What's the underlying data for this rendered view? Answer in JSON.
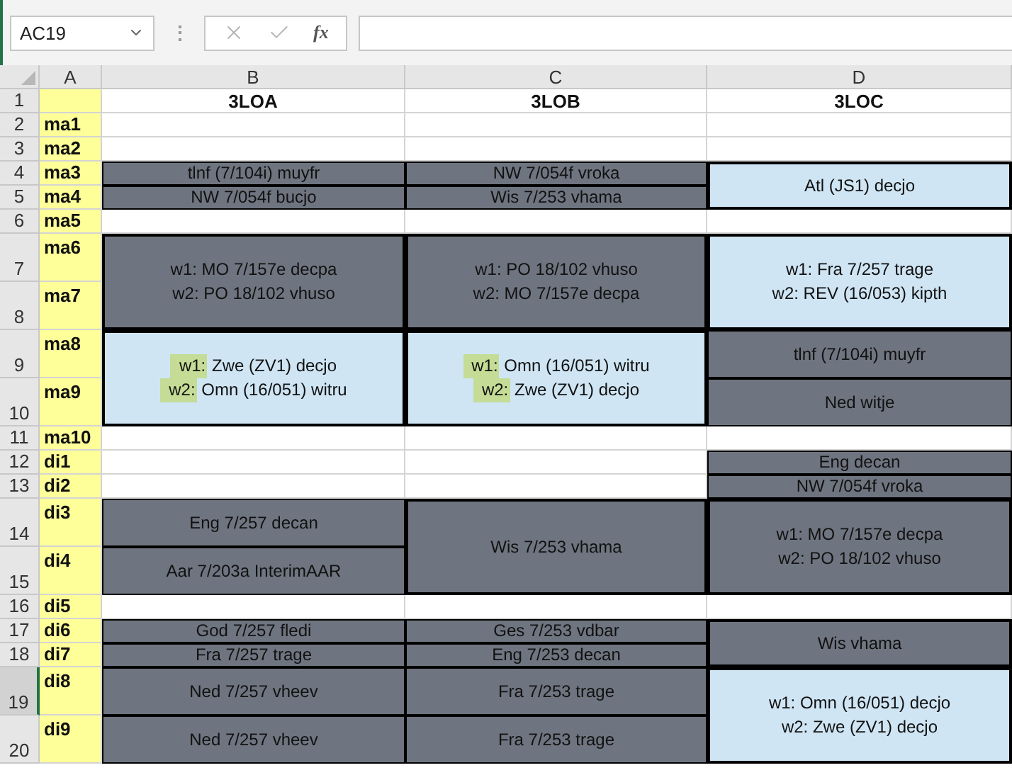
{
  "name_box": {
    "value": "AC19"
  },
  "formula_bar": {
    "function_button": "fx"
  },
  "columns": [
    {
      "letter": "A"
    },
    {
      "letter": "B"
    },
    {
      "letter": "C"
    },
    {
      "letter": "D"
    }
  ],
  "rows": [
    {
      "number": "1",
      "label": "",
      "selected": false,
      "tall": false,
      "cells": [
        {
          "kind": "header",
          "text": "3LOA"
        },
        {
          "kind": "header",
          "text": "3LOB"
        },
        {
          "kind": "header",
          "text": "3LOC"
        }
      ]
    },
    {
      "number": "2",
      "label": "ma1",
      "selected": false,
      "tall": false,
      "cells": [
        {
          "kind": "empty"
        },
        {
          "kind": "empty"
        },
        {
          "kind": "empty"
        }
      ]
    },
    {
      "number": "3",
      "label": "ma2",
      "selected": false,
      "tall": false,
      "cells": [
        {
          "kind": "empty"
        },
        {
          "kind": "empty"
        },
        {
          "kind": "empty"
        }
      ]
    },
    {
      "number": "4",
      "label": "ma3",
      "selected": false,
      "tall": false,
      "cells": [
        {
          "kind": "dark",
          "merged_down": false,
          "lines": [
            {
              "text": "tlnf (7/104i) muyfr"
            }
          ]
        },
        {
          "kind": "dark",
          "merged_down": false,
          "lines": [
            {
              "text": "NW 7/054f vroka"
            }
          ]
        },
        {
          "kind": "light",
          "merged_down": true,
          "lines": [
            {
              "text": "Atl (JS1) decjo"
            }
          ]
        }
      ]
    },
    {
      "number": "5",
      "label": "ma4",
      "selected": false,
      "tall": false,
      "cells": [
        {
          "kind": "dark",
          "merged_down": false,
          "lines": [
            {
              "text": "NW 7/054f bucjo"
            }
          ]
        },
        {
          "kind": "dark",
          "merged_down": false,
          "lines": [
            {
              "text": "Wis 7/253 vhama"
            }
          ]
        },
        {
          "kind": "covered"
        }
      ]
    },
    {
      "number": "6",
      "label": "ma5",
      "selected": false,
      "tall": false,
      "cells": [
        {
          "kind": "empty"
        },
        {
          "kind": "empty"
        },
        {
          "kind": "empty"
        }
      ]
    },
    {
      "number": "7",
      "label": "ma6",
      "selected": false,
      "tall": true,
      "cells": [
        {
          "kind": "dark",
          "merged_down": true,
          "lines": [
            {
              "text": "w1: MO 7/157e decpa"
            },
            {
              "text": "w2: PO 18/102 vhuso"
            }
          ]
        },
        {
          "kind": "dark",
          "merged_down": true,
          "lines": [
            {
              "text": "w1: PO 18/102 vhuso"
            },
            {
              "text": "w2: MO 7/157e decpa"
            }
          ]
        },
        {
          "kind": "light",
          "merged_down": true,
          "lines": [
            {
              "text": "w1: Fra 7/257 trage"
            },
            {
              "text": "w2: REV (16/053) kipth"
            }
          ]
        }
      ]
    },
    {
      "number": "8",
      "label": "ma7",
      "selected": false,
      "tall": true,
      "cells": [
        {
          "kind": "covered"
        },
        {
          "kind": "covered"
        },
        {
          "kind": "covered"
        }
      ]
    },
    {
      "number": "9",
      "label": "ma8",
      "selected": false,
      "tall": true,
      "cells": [
        {
          "kind": "light",
          "merged_down": true,
          "lines": [
            {
              "tag": "w1:",
              "text": "Zwe (ZV1) decjo"
            },
            {
              "tag": "w2:",
              "text": "Omn (16/051) witru"
            }
          ]
        },
        {
          "kind": "light",
          "merged_down": true,
          "lines": [
            {
              "tag": "w1:",
              "text": "Omn (16/051) witru"
            },
            {
              "tag": "w2:",
              "text": "Zwe (ZV1) decjo"
            }
          ]
        },
        {
          "kind": "dark",
          "merged_down": false,
          "lines": [
            {
              "text": "tlnf (7/104i) muyfr"
            }
          ]
        }
      ]
    },
    {
      "number": "10",
      "label": "ma9",
      "selected": false,
      "tall": true,
      "cells": [
        {
          "kind": "covered"
        },
        {
          "kind": "covered"
        },
        {
          "kind": "dark",
          "merged_down": false,
          "lines": [
            {
              "text": "Ned witje"
            }
          ]
        }
      ]
    },
    {
      "number": "11",
      "label": "ma10",
      "selected": false,
      "tall": false,
      "cells": [
        {
          "kind": "empty"
        },
        {
          "kind": "empty"
        },
        {
          "kind": "empty"
        }
      ]
    },
    {
      "number": "12",
      "label": "di1",
      "selected": false,
      "tall": false,
      "cells": [
        {
          "kind": "empty"
        },
        {
          "kind": "empty"
        },
        {
          "kind": "dark",
          "merged_down": false,
          "lines": [
            {
              "text": "Eng decan"
            }
          ]
        }
      ]
    },
    {
      "number": "13",
      "label": "di2",
      "selected": false,
      "tall": false,
      "cells": [
        {
          "kind": "empty"
        },
        {
          "kind": "empty"
        },
        {
          "kind": "dark",
          "merged_down": false,
          "lines": [
            {
              "text": "NW 7/054f vroka"
            }
          ]
        }
      ]
    },
    {
      "number": "14",
      "label": "di3",
      "selected": false,
      "tall": true,
      "cells": [
        {
          "kind": "dark",
          "merged_down": false,
          "lines": [
            {
              "text": "Eng 7/257 decan"
            }
          ]
        },
        {
          "kind": "dark",
          "merged_down": true,
          "lines": [
            {
              "text": "Wis 7/253 vhama"
            }
          ]
        },
        {
          "kind": "dark",
          "merged_down": true,
          "lines": [
            {
              "text": "w1: MO 7/157e decpa"
            },
            {
              "text": "w2: PO 18/102 vhuso"
            }
          ]
        }
      ]
    },
    {
      "number": "15",
      "label": "di4",
      "selected": false,
      "tall": true,
      "cells": [
        {
          "kind": "dark",
          "merged_down": false,
          "lines": [
            {
              "text": "Aar 7/203a InterimAAR"
            }
          ]
        },
        {
          "kind": "covered"
        },
        {
          "kind": "covered"
        }
      ]
    },
    {
      "number": "16",
      "label": "di5",
      "selected": false,
      "tall": false,
      "cells": [
        {
          "kind": "empty"
        },
        {
          "kind": "empty"
        },
        {
          "kind": "empty"
        }
      ]
    },
    {
      "number": "17",
      "label": "di6",
      "selected": false,
      "tall": false,
      "cells": [
        {
          "kind": "dark",
          "merged_down": false,
          "lines": [
            {
              "text": "God 7/257 fledi"
            }
          ]
        },
        {
          "kind": "dark",
          "merged_down": false,
          "lines": [
            {
              "text": "Ges 7/253 vdbar"
            }
          ]
        },
        {
          "kind": "dark",
          "merged_down": true,
          "lines": [
            {
              "text": "Wis vhama"
            }
          ]
        }
      ]
    },
    {
      "number": "18",
      "label": "di7",
      "selected": false,
      "tall": false,
      "cells": [
        {
          "kind": "dark",
          "merged_down": false,
          "lines": [
            {
              "text": "Fra 7/257 trage"
            }
          ]
        },
        {
          "kind": "dark",
          "merged_down": false,
          "lines": [
            {
              "text": "Eng 7/253 decan"
            }
          ]
        },
        {
          "kind": "covered"
        }
      ]
    },
    {
      "number": "19",
      "label": "di8",
      "selected": true,
      "tall": true,
      "cells": [
        {
          "kind": "dark",
          "merged_down": false,
          "lines": [
            {
              "text": "Ned 7/257 vheev"
            }
          ]
        },
        {
          "kind": "dark",
          "merged_down": false,
          "lines": [
            {
              "text": "Fra 7/253 trage"
            }
          ]
        },
        {
          "kind": "light",
          "merged_down": true,
          "lines": [
            {
              "text": "w1: Omn (16/051) decjo"
            },
            {
              "text": "w2: Zwe (ZV1) decjo"
            }
          ]
        }
      ]
    },
    {
      "number": "20",
      "label": "di9",
      "selected": false,
      "tall": true,
      "cells": [
        {
          "kind": "dark",
          "merged_down": false,
          "lines": [
            {
              "text": "Ned 7/257 vheev"
            }
          ]
        },
        {
          "kind": "dark",
          "merged_down": false,
          "lines": [
            {
              "text": "Fra 7/253 trage"
            }
          ]
        },
        {
          "kind": "covered"
        }
      ]
    }
  ]
}
